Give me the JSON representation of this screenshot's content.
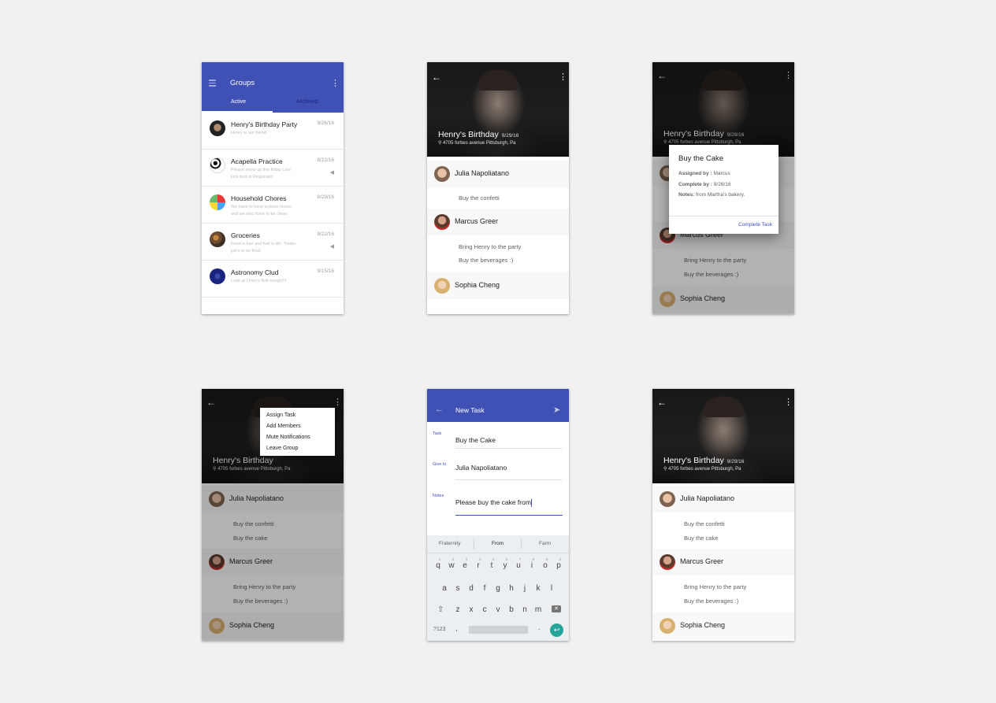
{
  "groups_screen": {
    "title": "Groups",
    "tabs": [
      "Active",
      "Archived"
    ],
    "groups": [
      {
        "name": "Henry's Birthday Party",
        "date": "9/26/16",
        "desc": "Henry is our friend.",
        "muted": false
      },
      {
        "name": "Acapella Practice",
        "date": "8/22/16",
        "desc": "Please show up this friday Lets kick butt at Regionals!",
        "muted": true
      },
      {
        "name": "Household Chores",
        "date": "8/29/16",
        "desc": "We have to have a clean house and we also have to be clean.",
        "muted": false
      },
      {
        "name": "Groceries",
        "date": "9/22/16",
        "desc": "Food is fuel and fuel is life. Trader joe's or no food",
        "muted": true
      },
      {
        "name": "Astronomy Clud",
        "date": "9/15/16",
        "desc": "Look at Orion's Belt tonight!!!",
        "muted": false
      }
    ],
    "mute_icon": "volume-off-icon"
  },
  "group_detail": {
    "title": "Henry's Birthday",
    "date": "9/29/16",
    "address": "4705 forbes avenue Pittsburgh, Pa",
    "members": [
      {
        "name": "Julia Napoliatano",
        "tasks": [
          "Buy the confetti",
          "Buy the cake"
        ]
      },
      {
        "name": "Marcus Greer",
        "tasks": [
          "Bring Henry to the party",
          "Buy the beverages :)"
        ]
      },
      {
        "name": "Sophia Cheng",
        "tasks": []
      }
    ]
  },
  "task_dialog": {
    "title": "Buy the Cake",
    "assigned_label": "Assigned by :",
    "assigned_value": "Marcus",
    "complete_label": "Complete by :",
    "complete_value": "9/26/16",
    "notes_label": "Notes:",
    "notes_value": "from Martha's bakery.",
    "action": "Complete Task"
  },
  "overflow_menu": {
    "items": [
      "Assign Task",
      "Add Members",
      "Mute Notifications",
      "Leave Group"
    ]
  },
  "new_task": {
    "title": "New Task",
    "fields": [
      {
        "label": "Task",
        "value": "Buy the Cake"
      },
      {
        "label": "Give to",
        "value": "Julia Napoliatano"
      },
      {
        "label": "Notes",
        "value": "Please buy the cake from"
      }
    ],
    "suggestions": [
      "Fraternity",
      "From",
      "Farm"
    ],
    "keyboard": {
      "row1": [
        "q",
        "w",
        "e",
        "r",
        "t",
        "y",
        "u",
        "i",
        "o",
        "p"
      ],
      "row1_nums": [
        "1",
        "2",
        "3",
        "4",
        "5",
        "6",
        "7",
        "8",
        "9",
        "0"
      ],
      "row2": [
        "a",
        "s",
        "d",
        "f",
        "g",
        "h",
        "j",
        "k",
        "l"
      ],
      "row3": [
        "z",
        "x",
        "c",
        "v",
        "b",
        "n",
        "m"
      ],
      "symbols_key": "?123",
      "comma": ",",
      "period": "."
    }
  },
  "colors": {
    "primary": "#3f51b5",
    "accent": "#26a69a",
    "background": "#f1f1f1"
  }
}
